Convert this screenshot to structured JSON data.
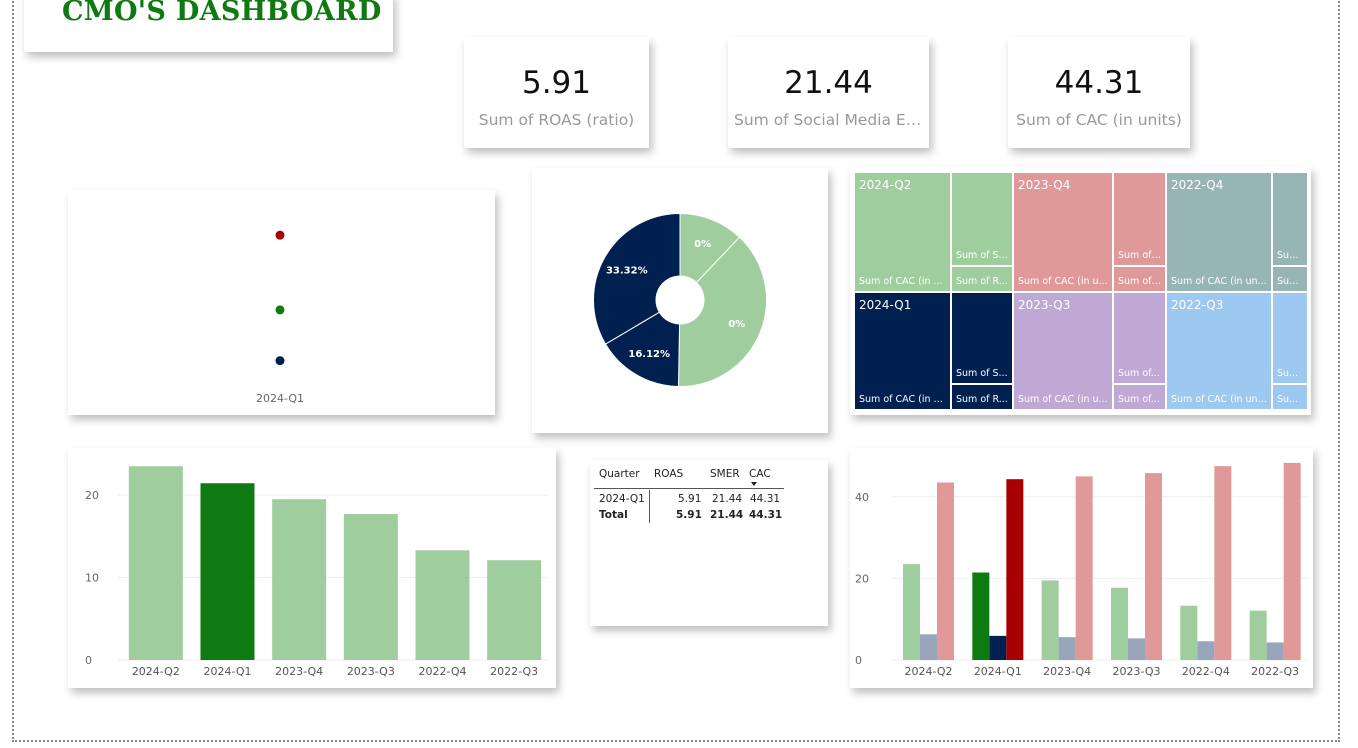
{
  "header": {
    "title": "CMO'S DASHBOARD"
  },
  "kpis": [
    {
      "value": "5.91",
      "label": "Sum of ROAS (ratio)"
    },
    {
      "value": "21.44",
      "label": "Sum of Social Media En..."
    },
    {
      "value": "44.31",
      "label": "Sum of CAC (in units)"
    }
  ],
  "colors": {
    "green_light": "#a0cd9e",
    "green_dark": "#0f7a12",
    "navy": "#002050",
    "navy_light": "#98a5bb",
    "red_light": "#df9999",
    "red_dark": "#a80000"
  },
  "chart_data": [
    {
      "type": "scatter",
      "categories": [
        "2024-Q1"
      ],
      "series": [
        {
          "values": [
            44.31
          ],
          "color": "#a80000"
        },
        {
          "values": [
            21.44
          ],
          "color": "#0f7a12"
        },
        {
          "values": [
            5.91
          ],
          "color": "#002050"
        }
      ],
      "xlabel": "",
      "ylabel": ""
    },
    {
      "type": "pie",
      "donut": true,
      "slice_labels": [
        "0%",
        "0%",
        "16.12%",
        "33.32%"
      ],
      "values": [
        12,
        38,
        16.12,
        33.32
      ],
      "colors": [
        "#a0cd9e",
        "#a0cd9e",
        "#002050",
        "#002050"
      ]
    },
    {
      "type": "treemap",
      "quarters": [
        {
          "label": "2024-Q2",
          "sub_main": "Sum of CAC (in ...",
          "sub_top": "Sum of S...",
          "sub_bottom": "Sum of R...",
          "color": "#a0cd9e"
        },
        {
          "label": "2023-Q4",
          "sub_main": "Sum of CAC (in u...",
          "sub_top": "Sum of ...",
          "sub_bottom": "Sum of ...",
          "color": "#df9999"
        },
        {
          "label": "2022-Q4",
          "sub_main": "Sum of CAC (in un...",
          "sub_top": "Sum...",
          "sub_bottom": "Sum...",
          "color": "#98b5b5"
        },
        {
          "label": "2024-Q1",
          "sub_main": "Sum of CAC (in u...",
          "sub_top": "Sum of S...",
          "sub_bottom": "Sum of R...",
          "color": "#002050"
        },
        {
          "label": "2023-Q3",
          "sub_main": "Sum of CAC (in u...",
          "sub_top": "Sum of...",
          "sub_bottom": "Sum of...",
          "color": "#c0a8d5"
        },
        {
          "label": "2022-Q3",
          "sub_main": "Sum of CAC (in uni...",
          "sub_top": "Su...",
          "sub_bottom": "Su...",
          "color": "#9dc8ef"
        }
      ]
    },
    {
      "type": "bar",
      "categories": [
        "2024-Q2",
        "2024-Q1",
        "2023-Q4",
        "2023-Q3",
        "2022-Q4",
        "2022-Q3"
      ],
      "values": [
        23.5,
        21.44,
        19.5,
        17.7,
        13.3,
        12.1
      ],
      "highlight_index": 1,
      "yticks": [
        0,
        10,
        20
      ],
      "ylim": [
        0,
        24.5
      ]
    },
    {
      "type": "table",
      "columns": [
        "Quarter",
        "ROAS",
        "SMER",
        "CAC"
      ],
      "rows": [
        [
          "2024-Q1",
          "5.91",
          "21.44",
          "44.31"
        ]
      ],
      "total": [
        "Total",
        "5.91",
        "21.44",
        "44.31"
      ]
    },
    {
      "type": "bar",
      "grouped": true,
      "categories": [
        "2024-Q2",
        "2024-Q1",
        "2023-Q4",
        "2023-Q3",
        "2022-Q4",
        "2022-Q3"
      ],
      "series": [
        {
          "values": [
            23.5,
            21.44,
            19.5,
            17.7,
            13.3,
            12.1
          ],
          "color": "#a0cd9e",
          "highlight": "#0f7a12"
        },
        {
          "values": [
            6.3,
            5.91,
            5.6,
            5.3,
            4.6,
            4.3
          ],
          "color": "#98a5bb",
          "highlight": "#002050"
        },
        {
          "values": [
            43.5,
            44.31,
            45,
            45.8,
            47.5,
            48.3
          ],
          "color": "#df9999",
          "highlight": "#a80000"
        }
      ],
      "highlight_index": 1,
      "yticks": [
        0,
        20,
        40
      ],
      "ylim": [
        0,
        49.5
      ]
    }
  ]
}
